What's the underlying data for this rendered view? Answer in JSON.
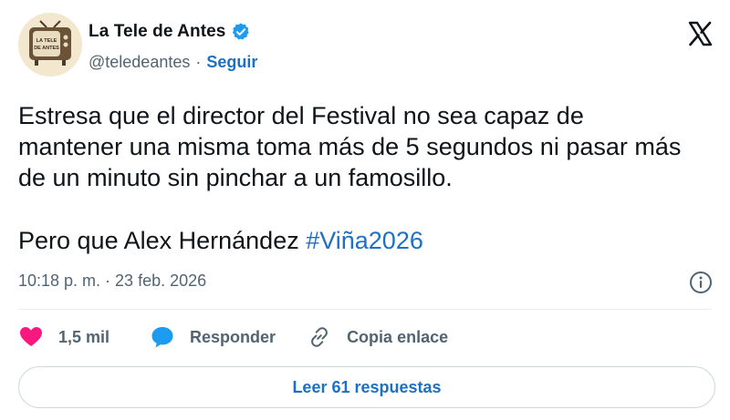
{
  "author": {
    "display_name": "La Tele de Antes",
    "handle": "@teledeantes",
    "separator": "·",
    "follow_label": "Seguir",
    "avatar_logo_text": "LA TELE DE ANTES",
    "verified": true
  },
  "tweet": {
    "paragraph1": "Estresa que el director del Festival no sea capaz de mantener una misma toma más de 5 segundos ni pasar más de un minuto sin pinchar a un famosillo.",
    "paragraph2_text": "Pero que Alex Hernández ",
    "hashtag": "#Viña2026",
    "timestamp": "10:18 p. m. · 23 feb. 2026"
  },
  "actions": {
    "like_count": "1,5 mil",
    "reply_label": "Responder",
    "copy_link_label": "Copia enlace",
    "read_replies_label": "Leer 61 respuestas"
  },
  "icons": {
    "platform": "x-logo-icon",
    "verified": "verified-badge-icon",
    "info": "info-icon",
    "like": "heart-icon",
    "reply": "speech-bubble-icon",
    "copy": "link-icon"
  },
  "colors": {
    "link_blue": "#1d70c4",
    "verified_blue": "#1d9bf0",
    "like_pink": "#f91880",
    "reply_blue": "#1d9bf0",
    "text": "#0f1419",
    "muted": "#536471"
  }
}
